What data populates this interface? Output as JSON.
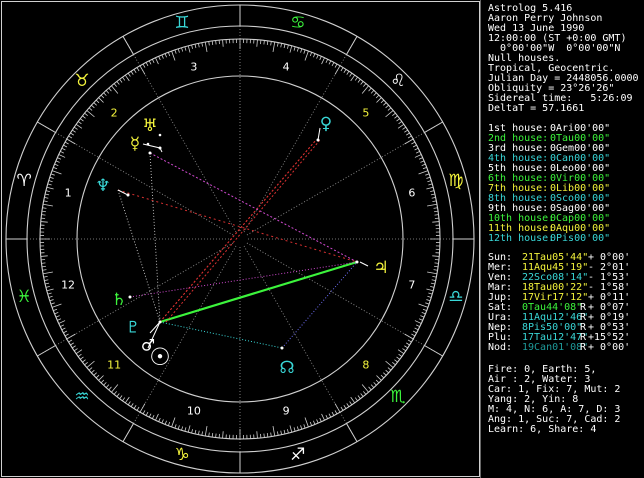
{
  "colors": {
    "background": "#000000",
    "frame": "#d0d0d0",
    "white": "#ffffff",
    "grey": "#b8b8b8",
    "green": "#3cf43c",
    "cyan": "#39d7d7",
    "yellow": "#f4f43c",
    "red": "#d83030",
    "blue": "#6e6ef4",
    "magenta": "#d04ad0",
    "darkcyan": "#1e9a9a"
  },
  "header": [
    "Astrolog 5.416",
    "Aaron Perry Johnson",
    "Wed 13 June 1990",
    "12:00:00 (ST +0:00 GMT)",
    "  0°00'00\"W  0°00'00\"N",
    "Null houses.",
    "Tropical, Geocentric.",
    "Julian Day = 2448056.0000",
    "Obliquity = 23°26'26\"",
    "Sidereal time:   5:26:09",
    "DeltaT = 57.1661"
  ],
  "houses": [
    {
      "label": "1st house:",
      "value": "0Ari00'00\"",
      "color": "#ffffff"
    },
    {
      "label": "2nd house:",
      "value": "0Tau00'00\"",
      "color": "#3cf43c"
    },
    {
      "label": "3rd house:",
      "value": "0Gem00'00\"",
      "color": "#ffffff"
    },
    {
      "label": "4th house:",
      "value": "0Can00'00\"",
      "color": "#39d7d7"
    },
    {
      "label": "5th house:",
      "value": "0Leo00'00\"",
      "color": "#ffffff"
    },
    {
      "label": "6th house:",
      "value": "0Vir00'00\"",
      "color": "#3cf43c"
    },
    {
      "label": "7th house:",
      "value": "0Lib00'00\"",
      "color": "#f4f43c"
    },
    {
      "label": "8th house:",
      "value": "0Sco00'00\"",
      "color": "#39d7d7"
    },
    {
      "label": "9th house:",
      "value": "0Sag00'00\"",
      "color": "#ffffff"
    },
    {
      "label": "10th house:",
      "value": "0Cap00'00\"",
      "color": "#3cf43c"
    },
    {
      "label": "11th house:",
      "value": "0Aqu00'00\"",
      "color": "#f4f43c"
    },
    {
      "label": "12th house:",
      "value": "0Pis00'00\"",
      "color": "#39d7d7"
    }
  ],
  "planets": [
    {
      "label": "Sun:",
      "position": "21Tau05'44\"",
      "retro": "",
      "speed": "+ 0°00'",
      "color": "#f4f43c"
    },
    {
      "label": "Mer:",
      "position": "11Aqu45'19\"",
      "retro": "",
      "speed": "- 2°01'",
      "color": "#f4f43c"
    },
    {
      "label": "Ven:",
      "position": "22Sco08'14\"",
      "retro": "",
      "speed": "- 1°53'",
      "color": "#39d7d7"
    },
    {
      "label": "Mar:",
      "position": "18Tau00'22\"",
      "retro": "",
      "speed": "- 1°58'",
      "color": "#f4f43c"
    },
    {
      "label": "Jup:",
      "position": "17Vir17'12\"",
      "retro": "",
      "speed": "+ 0°11'",
      "color": "#f4f43c"
    },
    {
      "label": "Sat:",
      "position": "0Tau44'08\"",
      "retro": "R",
      "speed": "+ 0°07'",
      "color": "#3cf43c"
    },
    {
      "label": "Ura:",
      "position": "11Aqu12'46\"",
      "retro": "R",
      "speed": "+ 0°19'",
      "color": "#39d7d7"
    },
    {
      "label": "Nep:",
      "position": "8Pis50'00\"",
      "retro": "R",
      "speed": "+ 0°53'",
      "color": "#39d7d7"
    },
    {
      "label": "Plu:",
      "position": "17Tau12'47\"",
      "retro": "R",
      "speed": "+15°52'",
      "color": "#39d7d7"
    },
    {
      "label": "Nod:",
      "position": "19Can01'08\"",
      "retro": "R",
      "speed": "+ 0°00'",
      "color": "#1e9a9a"
    }
  ],
  "summary": [
    "Fire: 0, Earth: 5,",
    "Air : 2, Water: 3",
    "Car: 1, Fix: 7, Mut: 2",
    "Yang: 2, Yin: 8",
    "M: 4, N: 6, A: 7, D: 3",
    "Ang: 1, Suc: 7, Cad: 2",
    "Learn: 6, Share: 4"
  ],
  "house_numbers": [
    "1",
    "2",
    "3",
    "4",
    "5",
    "6",
    "7",
    "8",
    "9",
    "10",
    "11",
    "12"
  ],
  "signs": [
    {
      "name": "aries",
      "glyph": "♈",
      "color": "#ffffff"
    },
    {
      "name": "taurus",
      "glyph": "♉",
      "color": "#f4f43c"
    },
    {
      "name": "gemini",
      "glyph": "♊",
      "color": "#39d7d7"
    },
    {
      "name": "cancer",
      "glyph": "♋",
      "color": "#3cf43c"
    },
    {
      "name": "leo",
      "glyph": "♌",
      "color": "#ffffff"
    },
    {
      "name": "virgo",
      "glyph": "♍",
      "color": "#f4f43c"
    },
    {
      "name": "libra",
      "glyph": "♎",
      "color": "#39d7d7"
    },
    {
      "name": "scorpio",
      "glyph": "♏",
      "color": "#3cf43c"
    },
    {
      "name": "sagittarius",
      "glyph": "♐",
      "color": "#ffffff"
    },
    {
      "name": "capricorn",
      "glyph": "♑",
      "color": "#f4f43c"
    },
    {
      "name": "aquarius",
      "glyph": "♒",
      "color": "#39d7d7"
    },
    {
      "name": "pisces",
      "glyph": "♓",
      "color": "#3cf43c"
    }
  ],
  "planet_glyphs": [
    {
      "name": "sun",
      "glyph": "☉",
      "color": "#ffffff"
    },
    {
      "name": "mercury",
      "glyph": "☿",
      "color": "#f4f43c"
    },
    {
      "name": "venus",
      "glyph": "♀",
      "color": "#39d7d7"
    },
    {
      "name": "mars",
      "glyph": "♂",
      "color": "#ffffff"
    },
    {
      "name": "jupiter",
      "glyph": "♃",
      "color": "#f4f43c"
    },
    {
      "name": "saturn",
      "glyph": "♄",
      "color": "#3cf43c"
    },
    {
      "name": "uranus",
      "glyph": "♅",
      "color": "#f4f43c"
    },
    {
      "name": "neptune",
      "glyph": "♆",
      "color": "#39d7d7"
    },
    {
      "name": "pluto",
      "glyph": "♇",
      "color": "#39d7d7"
    },
    {
      "name": "node",
      "glyph": "☊",
      "color": "#39d7d7"
    }
  ]
}
